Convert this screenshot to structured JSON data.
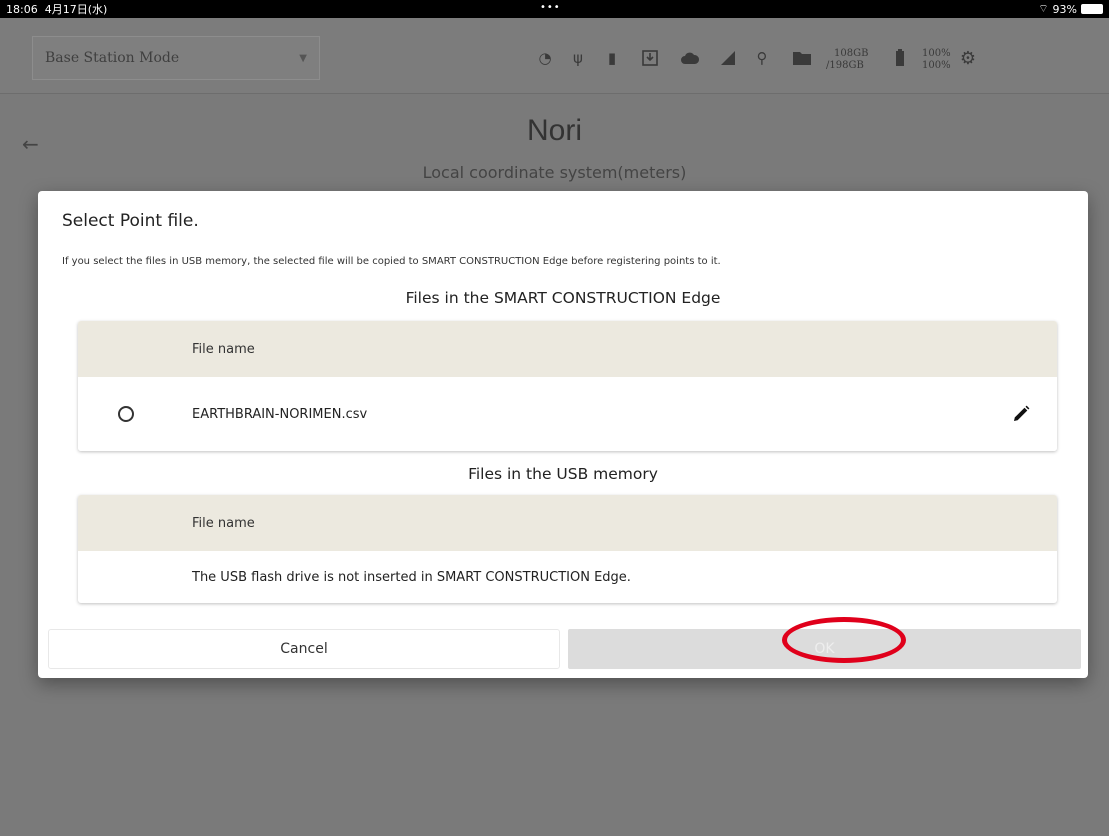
{
  "status_bar": {
    "time": "18:06",
    "date": "4月17日(水)",
    "dots": "•••",
    "wifi_battery": "93%"
  },
  "toolbar": {
    "mode_select_value": "Base Station Mode",
    "storage_used": "108GB",
    "storage_total": "/198GB",
    "battery_1": "100%",
    "battery_2": "100%",
    "icons": [
      "clock-icon",
      "usb-icon",
      "sd-card-icon",
      "download-box-icon",
      "cloud-icon",
      "signal-icon",
      "satellite-icon",
      "folder-icon",
      "battery-icon",
      "gear-icon"
    ]
  },
  "page": {
    "title": "Nori",
    "subtitle": "Local coordinate system(meters)"
  },
  "dialog": {
    "title": "Select Point file.",
    "info": "If you select the files in USB memory, the selected file will be copied to SMART CONSTRUCTION Edge before registering points to it.",
    "edge_section": {
      "title": "Files in the SMART CONSTRUCTION Edge",
      "column_header": "File name",
      "rows": [
        {
          "file_name": "EARTHBRAIN-NORIMEN.csv"
        }
      ]
    },
    "usb_section": {
      "title": "Files in the USB memory",
      "column_header": "File name",
      "message": "The USB flash drive is not inserted in SMART CONSTRUCTION Edge."
    },
    "cancel_label": "Cancel",
    "ok_label": "OK"
  },
  "colors": {
    "annotation": "#e0001b",
    "header_row_bg": "#ece9df",
    "ok_disabled_bg": "#dcdcdc"
  }
}
